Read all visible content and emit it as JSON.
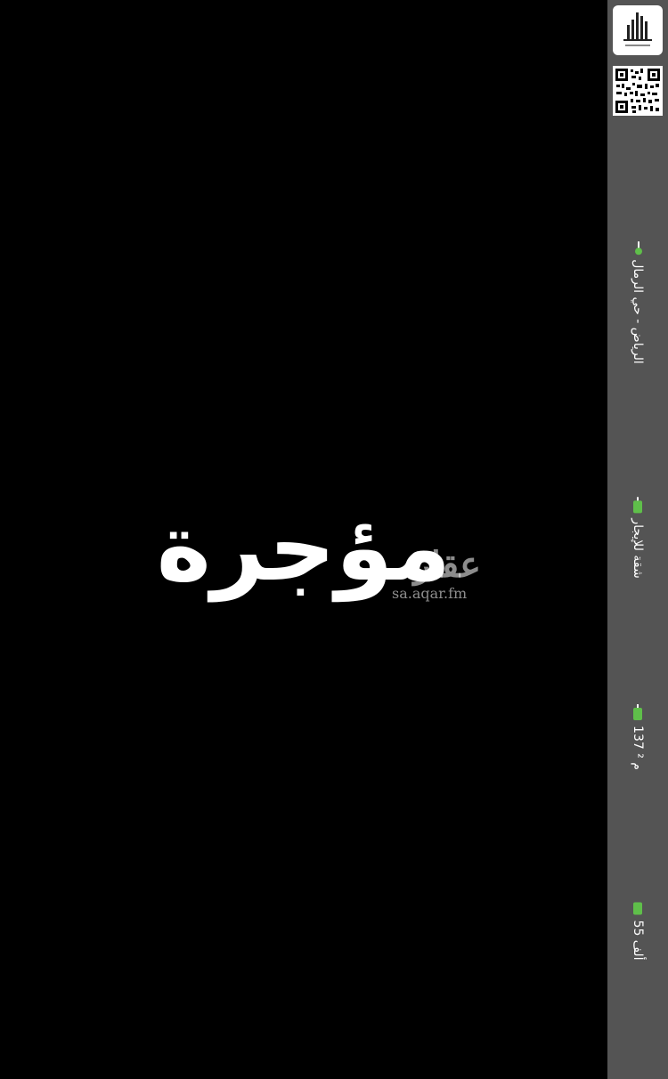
{
  "main": {
    "center_text": "مؤجرة",
    "watermark": {
      "logo": "عقار",
      "url": "sa.aqar.fm"
    }
  },
  "sidebar": {
    "logo_icon": "building-logo-icon",
    "qr_icon": "qr-code-icon",
    "location": {
      "icon": "location-pin-icon",
      "text": "الرياض - حي الرمال"
    },
    "type": {
      "icon": "property-type-icon",
      "text": "شقة للإيجار"
    },
    "area": {
      "icon": "area-icon",
      "text": "137 م ²"
    },
    "price": {
      "icon": "price-icon",
      "text": "55 ألف"
    }
  },
  "colors": {
    "sidebar_bg": "#545454",
    "accent_green": "#5fbf4a",
    "main_bg": "#000000"
  }
}
